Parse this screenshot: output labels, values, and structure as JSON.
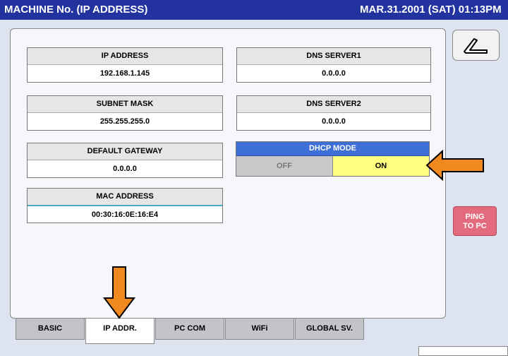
{
  "titlebar": {
    "title": "MACHINE No. (IP ADDRESS)",
    "clock": "MAR.31.2001 (SAT)  01:13PM"
  },
  "fields": {
    "ip_address": {
      "label": "IP ADDRESS",
      "value": "192.168.1.145"
    },
    "subnet_mask": {
      "label": "SUBNET MASK",
      "value": "255.255.255.0"
    },
    "default_gateway": {
      "label": "DEFAULT GATEWAY",
      "value": "0.0.0.0"
    },
    "mac_address": {
      "label": "MAC ADDRESS",
      "value": "00:30:16:0E:16:E4"
    },
    "dns_server1": {
      "label": "DNS SERVER1",
      "value": "0.0.0.0"
    },
    "dns_server2": {
      "label": "DNS SERVER2",
      "value": "0.0.0.0"
    }
  },
  "dhcp": {
    "label": "DHCP MODE",
    "off": "OFF",
    "on": "ON",
    "selected": "ON"
  },
  "side": {
    "back_icon": "return-arrow-icon",
    "ping_line1": "PING",
    "ping_line2": "TO PC"
  },
  "tabs": [
    {
      "label": "BASIC"
    },
    {
      "label": "IP ADDR.",
      "active": true
    },
    {
      "label": "PC COM"
    },
    {
      "label": "WiFi"
    },
    {
      "label": "GLOBAL SV."
    }
  ],
  "colors": {
    "titlebar": "#2233a0",
    "dhcp_header": "#3d6fd6",
    "dhcp_on": "#ffff80",
    "ping_button": "#e46a7e",
    "callout_arrow": "#f08a20"
  }
}
